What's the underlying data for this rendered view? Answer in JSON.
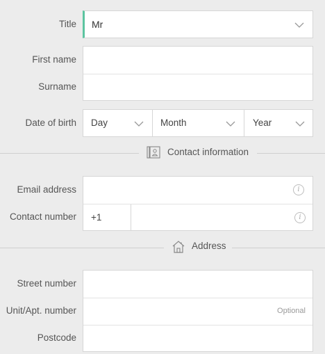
{
  "personal": {
    "title_label": "Title",
    "title_value": "Mr",
    "first_name_label": "First name",
    "first_name_value": "",
    "surname_label": "Surname",
    "surname_value": "",
    "dob_label": "Date of birth",
    "dob_day": "Day",
    "dob_month": "Month",
    "dob_year": "Year"
  },
  "contact": {
    "section_title": "Contact information",
    "email_label": "Email address",
    "email_value": "",
    "number_label": "Contact number",
    "country_code": "+1",
    "number_value": "",
    "info_glyph": "i"
  },
  "address": {
    "section_title": "Address",
    "street_label": "Street number",
    "street_value": "",
    "unit_label": "Unit/Apt. number",
    "unit_optional": "Optional",
    "unit_value": "",
    "postcode_label": "Postcode",
    "postcode_value": ""
  },
  "colors": {
    "accent": "#5cc4a0",
    "background": "#ececec",
    "border": "#d6d6d6"
  }
}
